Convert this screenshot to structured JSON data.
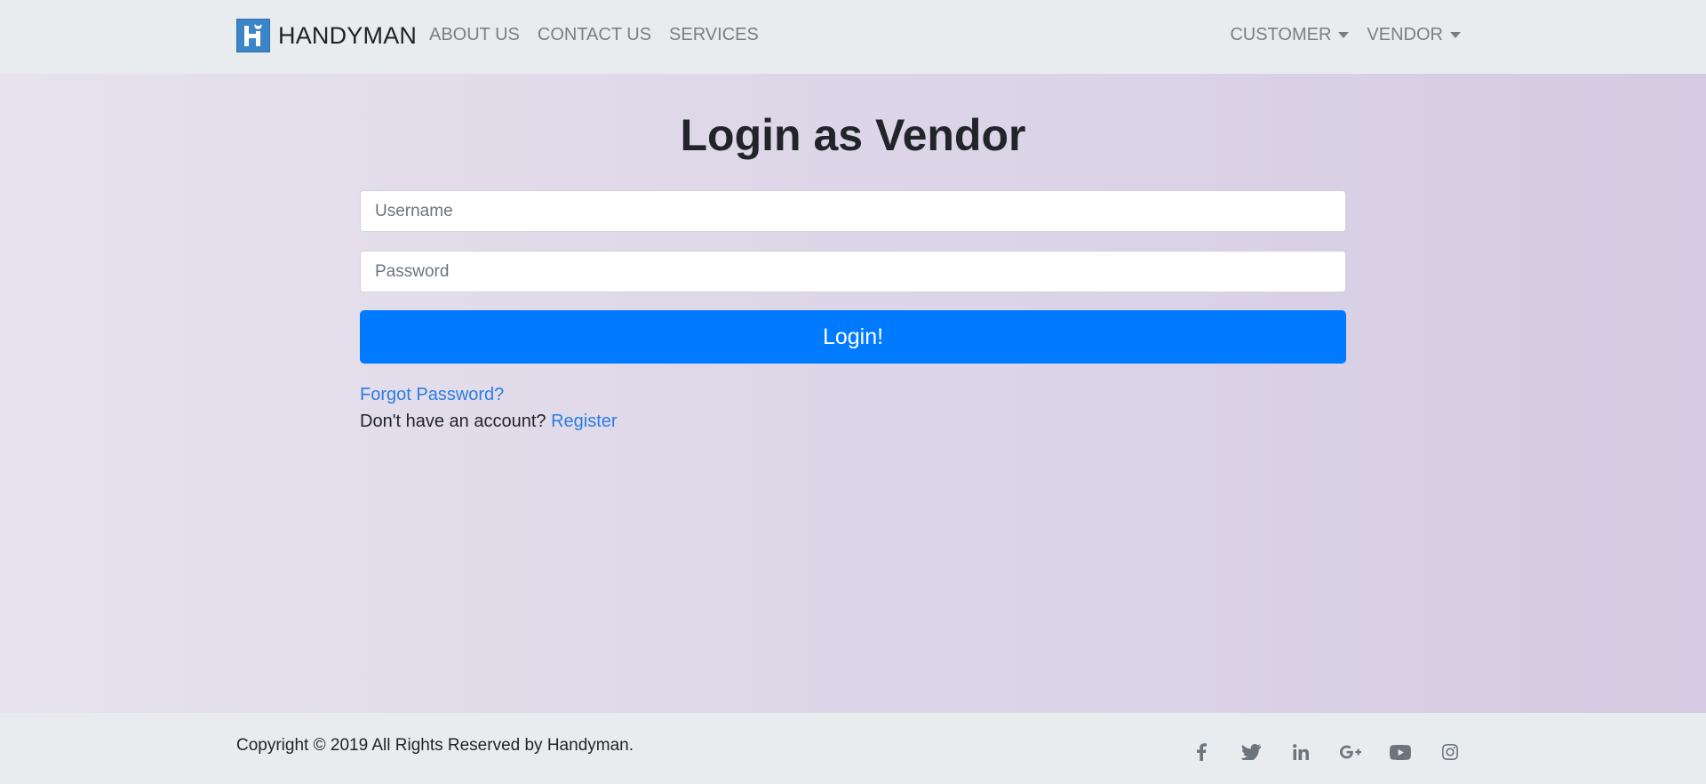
{
  "navbar": {
    "brand": "HANDYMAN",
    "links": [
      "ABOUT US",
      "CONTACT US",
      "SERVICES"
    ],
    "dropdowns": [
      "CUSTOMER",
      "VENDOR"
    ]
  },
  "login": {
    "title": "Login as Vendor",
    "username_placeholder": "Username",
    "password_placeholder": "Password",
    "submit_label": "Login!",
    "forgot_label": "Forgot Password?",
    "no_account_text": "Don't have an account?",
    "register_label": "Register"
  },
  "footer": {
    "copyright": "Copyright © 2019 All Rights Reserved by Handyman.",
    "social_icons": [
      "facebook-icon",
      "twitter-icon",
      "linkedin-icon",
      "google-plus-icon",
      "youtube-icon",
      "instagram-icon"
    ]
  },
  "colors": {
    "primary": "#007bff",
    "link": "#2a7de1",
    "nav_bg": "#e9ecef",
    "logo_bg": "#3a86c8"
  }
}
